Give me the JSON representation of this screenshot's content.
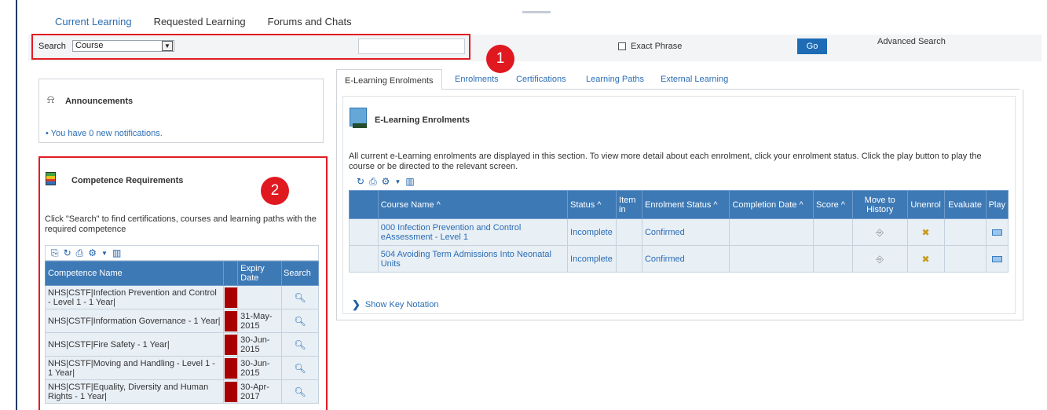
{
  "top_tabs": [
    {
      "label": "Current Learning",
      "active": true
    },
    {
      "label": "Requested Learning",
      "active": false
    },
    {
      "label": "Forums and Chats",
      "active": false
    }
  ],
  "search": {
    "label": "Search",
    "select_value": "Course",
    "input_value": "",
    "exact_phrase_label": "Exact Phrase",
    "go_label": "Go",
    "advanced_label": "Advanced Search"
  },
  "badges": {
    "one": "1",
    "two": "2"
  },
  "announcements": {
    "title": "Announcements",
    "bullet": "•",
    "link": "You have 0 new notifications."
  },
  "competence": {
    "title": "Competence Requirements",
    "description": "Click \"Search\" to find certifications, courses and learning paths with the required competence",
    "columns": {
      "name": "Competence Name",
      "expiry": "Expiry Date",
      "search": "Search"
    },
    "rows": [
      {
        "name": "NHS|CSTF|Infection Prevention and Control - Level 1 - 1 Year|",
        "expiry": ""
      },
      {
        "name": "NHS|CSTF|Information Governance - 1 Year|",
        "expiry": "31-May-2015"
      },
      {
        "name": "NHS|CSTF|Fire Safety - 1 Year|",
        "expiry": "30-Jun-2015"
      },
      {
        "name": "NHS|CSTF|Moving and Handling - Level 1 - 1 Year|",
        "expiry": "30-Jun-2015"
      },
      {
        "name": "NHS|CSTF|Equality, Diversity and Human Rights - 1 Year|",
        "expiry": "30-Apr-2017"
      }
    ]
  },
  "right_tabs": [
    {
      "label": "E-Learning Enrolments",
      "active": true
    },
    {
      "label": "Enrolments",
      "active": false
    },
    {
      "label": "Certifications",
      "active": false
    },
    {
      "label": "Learning Paths",
      "active": false
    },
    {
      "label": "External Learning",
      "active": false
    }
  ],
  "enrolments": {
    "title": "E-Learning Enrolments",
    "description": "All current e-Learning enrolments are displayed in this section. To view more detail about each enrolment, click your enrolment status. Click the play button to play the course or be directed to the relevant screen.",
    "columns": {
      "course": "Course Name ^",
      "status": "Status ^",
      "item": "Item in",
      "enrolment_status": "Enrolment Status ^",
      "completion": "Completion Date ^",
      "score": "Score ^",
      "history": "Move to History",
      "unenrol": "Unenrol",
      "evaluate": "Evaluate",
      "play": "Play"
    },
    "rows": [
      {
        "course": "000 Infection Prevention and Control eAssessment - Level 1",
        "status": "Incomplete",
        "enrolment_status": "Confirmed"
      },
      {
        "course": "504 Avoiding Term Admissions Into Neonatal Units",
        "status": "Incomplete",
        "enrolment_status": "Confirmed"
      }
    ],
    "show_key": "Show Key Notation"
  },
  "colors": {
    "accent": "#2a6db5",
    "header": "#3d79b5",
    "highlight": "#e21b23",
    "flag": "#a80000"
  }
}
